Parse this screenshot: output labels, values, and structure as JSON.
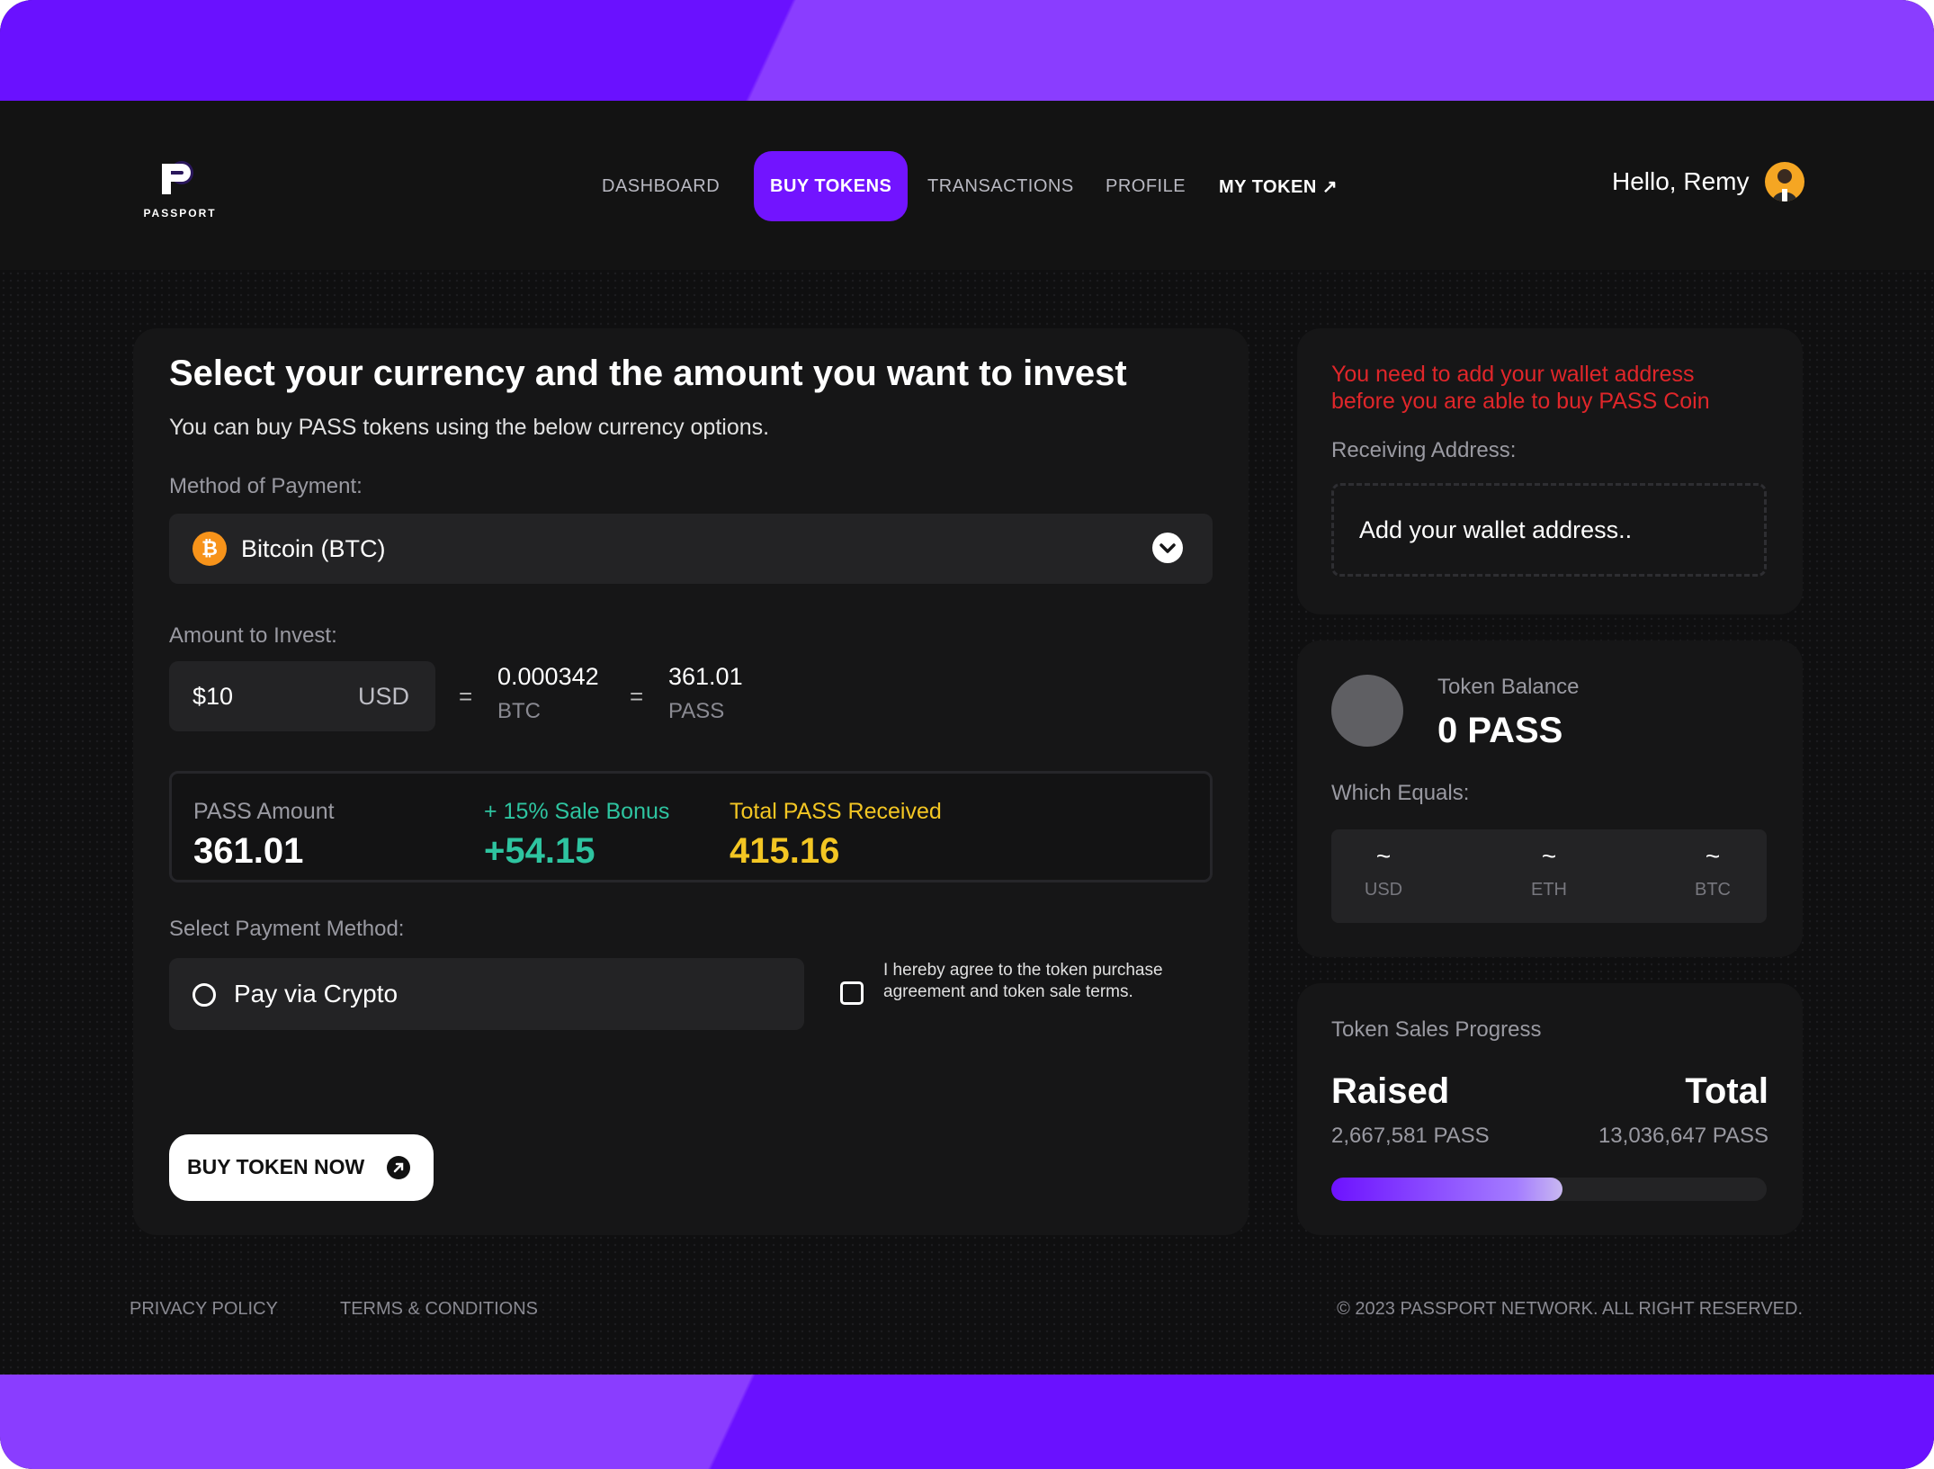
{
  "brand": {
    "logo_text": "PASSPORT",
    "accent": "#7214ff",
    "accent_light": "#8a3dff"
  },
  "nav": {
    "items": [
      {
        "label": "DASHBOARD"
      },
      {
        "label": "BUY TOKENS",
        "active": true
      },
      {
        "label": "TRANSACTIONS"
      },
      {
        "label": "PROFILE"
      },
      {
        "label": "MY TOKEN ↗"
      }
    ]
  },
  "user": {
    "greeting": "Hello, Remy"
  },
  "invest": {
    "title": "Select your currency and the amount you want to invest",
    "subtitle": "You can buy PASS tokens using the below currency options.",
    "method_label": "Method of Payment:",
    "method_value": "Bitcoin (BTC)",
    "btc_symbol": "₿",
    "amount_label": "Amount to Invest:",
    "amount_value": "$10",
    "amount_currency": "USD",
    "eq1": "=",
    "btc_value": "0.000342",
    "btc_unit": "BTC",
    "eq2": "=",
    "pass_value": "361.01",
    "pass_unit": "PASS",
    "summary": {
      "pass_amount_label": "PASS Amount",
      "pass_amount": "361.01",
      "bonus_label": "+ 15% Sale Bonus",
      "bonus_value": "+54.15",
      "total_label": "Total PASS Received",
      "total_value": "415.16",
      "bonus_color": "#2ec4a0",
      "total_color": "#f3c623"
    },
    "payment_method_label": "Select Payment Method:",
    "pay_option": "Pay via Crypto",
    "agree_text": "I hereby agree to the token purchase agreement and token sale terms.",
    "buy_button": "BUY TOKEN NOW"
  },
  "wallet": {
    "warning": "You need to add your wallet address before you are able to buy PASS Coin",
    "receiving_label": "Receiving Address:",
    "address_placeholder": "Add your wallet address.."
  },
  "balance": {
    "label": "Token Balance",
    "value": "0 PASS",
    "equals_label": "Which Equals:",
    "equivalents": [
      {
        "value": "~",
        "unit": "USD"
      },
      {
        "value": "~",
        "unit": "ETH"
      },
      {
        "value": "~",
        "unit": "BTC"
      }
    ]
  },
  "sales": {
    "label": "Token Sales Progress",
    "raised_label": "Raised",
    "raised_value": "2,667,581 PASS",
    "total_label": "Total",
    "total_value": "13,036,647 PASS",
    "progress_fraction": 0.53
  },
  "footer": {
    "privacy": "PRIVACY POLICY",
    "terms": "TERMS & CONDITIONS",
    "copyright": "© 2023 PASSPORT NETWORK. ALL RIGHT RESERVED."
  }
}
